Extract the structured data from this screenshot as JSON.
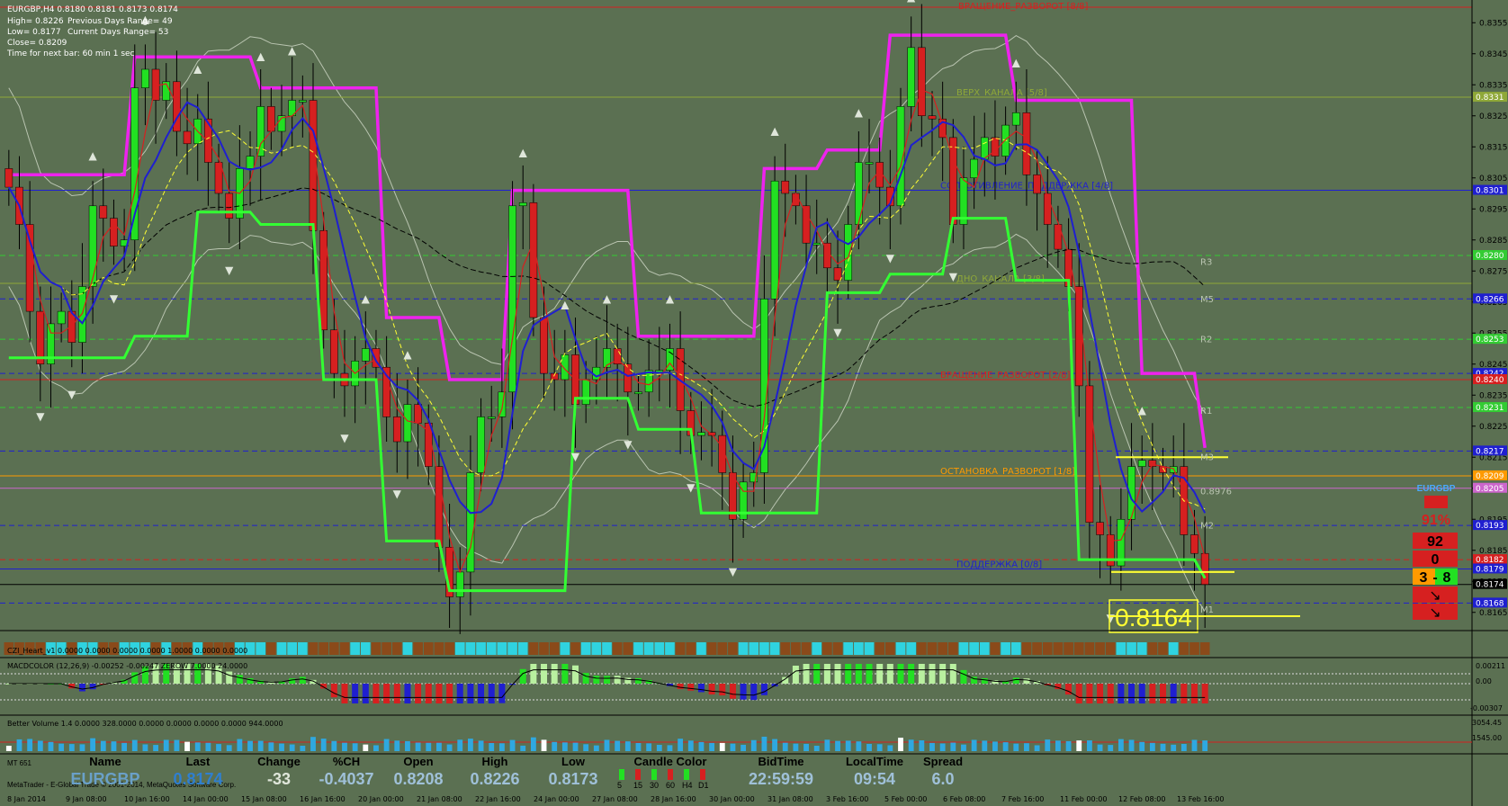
{
  "info": {
    "symbol_line": "EURGBP,H4  0.8180 0.8181 0.8173 0.8174",
    "high": "High= 0.8226",
    "low": "Low= 0.8177",
    "close": "Close= 0.8209",
    "prev_range": "Previous Days Range= 49",
    "cur_range": "Current Days Range= 53",
    "timer": "Time for next bar: 60 min 1 sec"
  },
  "colors": {
    "background": "#5b7052",
    "bull": "#22e022",
    "bear": "#d62020",
    "magenta": "#ee22ee",
    "green_line": "#33ff33",
    "blue_line": "#1f1fd0",
    "yellow": "#ffff33",
    "orange": "#ff9a00"
  },
  "price_axis": {
    "min": 0.816,
    "max": 0.836,
    "ticks": [
      "0.8355",
      "0.8345",
      "0.8335",
      "0.8325",
      "0.8315",
      "0.8305",
      "0.8295",
      "0.8285",
      "0.8275",
      "0.8265",
      "0.8255",
      "0.8245",
      "0.8235",
      "0.8225",
      "0.8215",
      "0.8205",
      "0.8195",
      "0.8185",
      "0.8175",
      "0.8165"
    ]
  },
  "levels": [
    {
      "label": "ВРАЩЕНИЕ_РАЗВОРОТ [8/8]",
      "price": 0.836,
      "color": "#d62020",
      "style": "solid",
      "badge": ""
    },
    {
      "label": "ВЕРХ_КАНАЛА [5/8]",
      "price": 0.8331,
      "color": "#8fa838",
      "style": "solid",
      "badge": "0.8331"
    },
    {
      "label": "СОПРОТИВЛЕНИЕ_ПОДДЕРЖКА [4/8]",
      "price": 0.8301,
      "color": "#1f1fd0",
      "style": "solid",
      "badge": "0.8301"
    },
    {
      "label": "",
      "price": 0.828,
      "color": "#33cc33",
      "style": "dash",
      "badge": "0.8280"
    },
    {
      "label": "ДНО_КАНАЛА [3/8]",
      "price": 0.8271,
      "color": "#8fa838",
      "style": "solid",
      "badge": ""
    },
    {
      "label": "",
      "price": 0.8266,
      "color": "#1f1fd0",
      "style": "dash",
      "badge": "0.8266"
    },
    {
      "label": "",
      "price": 0.8253,
      "color": "#33cc33",
      "style": "dash",
      "badge": "0.8253"
    },
    {
      "label": "",
      "price": 0.8242,
      "color": "#1f1fd0",
      "style": "dash",
      "badge": "0.8242"
    },
    {
      "label": "ВРАЩЕНИЕ_РАЗВОРОТ [2/8]",
      "price": 0.824,
      "color": "#d62020",
      "style": "solid",
      "badge": "0.8240"
    },
    {
      "label": "",
      "price": 0.8231,
      "color": "#33cc33",
      "style": "dash",
      "badge": "0.8231"
    },
    {
      "label": "",
      "price": 0.8217,
      "color": "#1f1fd0",
      "style": "dash",
      "badge": "0.8217"
    },
    {
      "label": "ОСТАНОВКА_РАЗВОРОТ [1/8]",
      "price": 0.8209,
      "color": "#ff9a00",
      "style": "solid",
      "badge": "0.8209"
    },
    {
      "label": "",
      "price": 0.8205,
      "color": "#cc66cc",
      "style": "solid",
      "badge": "0.8205"
    },
    {
      "label": "",
      "price": 0.8193,
      "color": "#1f1fd0",
      "style": "dash",
      "badge": "0.8193"
    },
    {
      "label": "",
      "price": 0.8182,
      "color": "#d62020",
      "style": "dash",
      "badge": "0.8182"
    },
    {
      "label": "ПОДДЕРЖКА [0/8]",
      "price": 0.8179,
      "color": "#1f1fd0",
      "style": "solid",
      "badge": "0.8179"
    },
    {
      "label": "",
      "price": 0.8174,
      "color": "#000000",
      "style": "solid",
      "badge": "0.8174"
    },
    {
      "label": "",
      "price": 0.8168,
      "color": "#1f1fd0",
      "style": "dash",
      "badge": "0.8168"
    }
  ],
  "pivot_labels": [
    {
      "text": "R3",
      "price": 0.8277
    },
    {
      "text": "M5",
      "price": 0.8265
    },
    {
      "text": "R2",
      "price": 0.8252
    },
    {
      "text": "R1",
      "price": 0.8229
    },
    {
      "text": "M3",
      "price": 0.8214
    },
    {
      "text": "0.8976",
      "price": 0.8203
    },
    {
      "text": "M2",
      "price": 0.8192
    },
    {
      "text": "M1",
      "price": 0.8165
    }
  ],
  "big_price": "0.8164",
  "side_panel": {
    "symbol": "EURGBP",
    "percent": "91%",
    "values": [
      "92",
      "0"
    ],
    "split_left": "3",
    "split_right": "8"
  },
  "indicators": {
    "czi": "CZI_Heart_v1 0.0000 0.0000 0.0000 0.0000 1.0000 0.0000 0.0000",
    "macd": "MACDCOLOR (12,26,9) -0.00252 -0.00247 ZEROW 7.0000 24.0000",
    "macd_ticks": [
      "0.00211",
      "0.00",
      "-0.00307"
    ],
    "volume": "Better Volume 1.4 0.0000 328.0000 0.0000 0.0000 0.0000 0.0000 944.0000",
    "volume_ticks": [
      "3054.45",
      "1545.00"
    ]
  },
  "bottom": {
    "mt": "MT 651",
    "copyright": "MetaTrader - E-Global Trade © 2001-2014, MetaQuotes Software Corp.",
    "headers": [
      "Name",
      "Last",
      "Change",
      "%CH",
      "Open",
      "High",
      "Low",
      "Candle Color",
      "BidTime",
      "LocalTime",
      "Spread"
    ],
    "values": [
      "EURGBP",
      "0.8174",
      "-33",
      "-0.4037",
      "0.8208",
      "0.8226",
      "0.8173",
      "",
      "22:59:59",
      "09:54",
      "6.0"
    ],
    "candle_tfs": [
      "5",
      "15",
      "30",
      "60",
      "H4",
      "D1"
    ]
  },
  "time_axis": [
    "8 Jan 2014",
    "9 Jan 08:00",
    "10 Jan 16:00",
    "14 Jan 00:00",
    "15 Jan 08:00",
    "16 Jan 16:00",
    "20 Jan 00:00",
    "21 Jan 08:00",
    "22 Jan 16:00",
    "24 Jan 00:00",
    "27 Jan 08:00",
    "28 Jan 16:00",
    "30 Jan 00:00",
    "31 Jan 08:00",
    "3 Feb 16:00",
    "5 Feb 00:00",
    "6 Feb 08:00",
    "7 Feb 16:00",
    "11 Feb 00:00",
    "12 Feb 08:00",
    "13 Feb 16:00"
  ],
  "chart_data": {
    "type": "candlestick",
    "title": "EURGBP,H4",
    "ylim": [
      0.816,
      0.836
    ],
    "close_path": [
      0.8302,
      0.829,
      0.8262,
      0.8245,
      0.8258,
      0.8262,
      0.8252,
      0.827,
      0.8296,
      0.8292,
      0.8283,
      0.8285,
      0.8334,
      0.834,
      0.833,
      0.8336,
      0.832,
      0.8316,
      0.8324,
      0.831,
      0.83,
      0.8292,
      0.8308,
      0.8312,
      0.8328,
      0.832,
      0.8325,
      0.833,
      0.833,
      0.8288,
      0.8256,
      0.8242,
      0.8238,
      0.8246,
      0.825,
      0.8244,
      0.8228,
      0.822,
      0.8232,
      0.8226,
      0.8212,
      0.8186,
      0.817,
      0.8178,
      0.821,
      0.8228,
      0.8228,
      0.8236,
      0.8296,
      0.8297,
      0.826,
      0.8242,
      0.824,
      0.8248,
      0.8232,
      0.824,
      0.8244,
      0.825,
      0.8245,
      0.8236,
      0.8236,
      0.8243,
      0.8243,
      0.825,
      0.823,
      0.8222,
      0.8223,
      0.8222,
      0.821,
      0.8195,
      0.8207,
      0.821,
      0.8266,
      0.8304,
      0.83,
      0.8296,
      0.8284,
      0.8284,
      0.8276,
      0.8272,
      0.829,
      0.831,
      0.831,
      0.8302,
      0.8296,
      0.8328,
      0.8347,
      0.8325,
      0.8324,
      0.8318,
      0.829,
      0.8305,
      0.8311,
      0.8318,
      0.8312,
      0.8322,
      0.8326,
      0.8306,
      0.83,
      0.829,
      0.8282,
      0.827,
      0.8238,
      0.8194,
      0.819,
      0.818,
      0.8195,
      0.8212,
      0.8214,
      0.8212,
      0.821,
      0.8212,
      0.819,
      0.8184,
      0.8174
    ]
  }
}
